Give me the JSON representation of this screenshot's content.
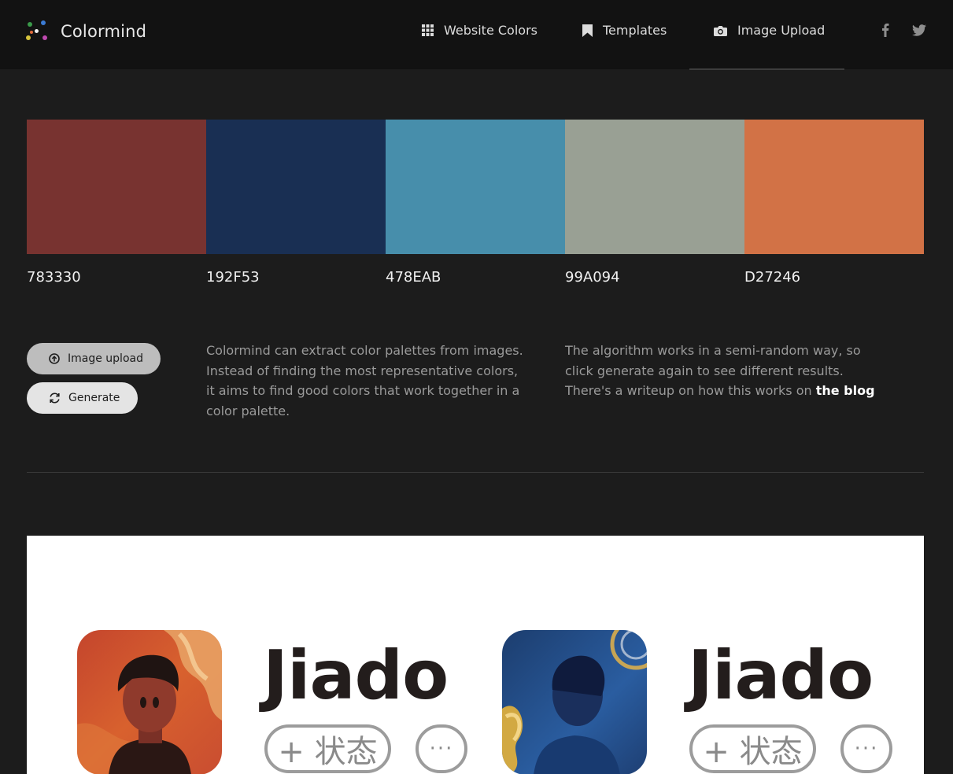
{
  "app": {
    "name": "Colormind"
  },
  "nav": {
    "items": [
      {
        "label": "Website Colors",
        "icon": "grid-icon"
      },
      {
        "label": "Templates",
        "icon": "bookmark-icon"
      },
      {
        "label": "Image Upload",
        "icon": "camera-icon"
      }
    ],
    "social": [
      "facebook-icon",
      "twitter-icon"
    ]
  },
  "palette": [
    {
      "hex": "783330",
      "color": "#783330"
    },
    {
      "hex": "192F53",
      "color": "#192F53"
    },
    {
      "hex": "478EAB",
      "color": "#478EAB"
    },
    {
      "hex": "99A094",
      "color": "#99A094"
    },
    {
      "hex": "D27246",
      "color": "#D27246"
    }
  ],
  "actions": {
    "upload_label": "Image upload",
    "generate_label": "Generate"
  },
  "descriptions": {
    "left": "Colormind can extract color palettes from images. Instead of finding the most representative colors, it aims to find good colors that work together in a color palette.",
    "right_text": "The algorithm works in a semi-random way, so click generate again to see different results. There's a writeup on how this works on ",
    "right_link": "the blog"
  },
  "preview": {
    "cards": [
      {
        "name": "Jiado",
        "status_label": "+ 状态",
        "more_label": "···"
      },
      {
        "name": "Jiado",
        "status_label": "+ 状态",
        "more_label": "···"
      }
    ]
  }
}
